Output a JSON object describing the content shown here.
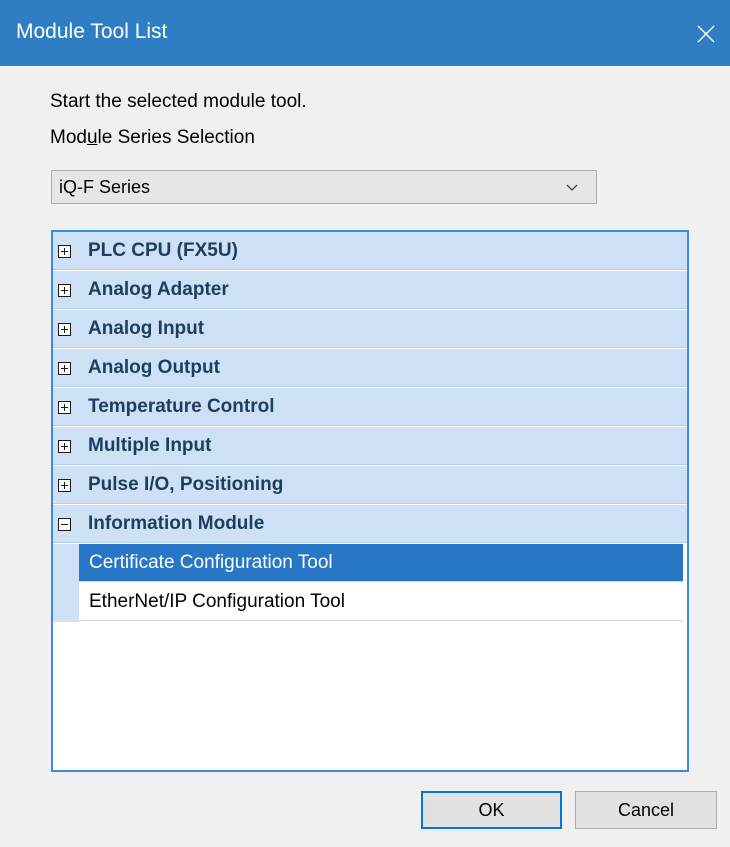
{
  "window": {
    "title": "Module Tool List"
  },
  "instructions": {
    "line1": "Start the selected module tool.",
    "line2_pre": "Mod",
    "line2_acc": "u",
    "line2_post": "le Series Selection"
  },
  "series_select": {
    "value": "iQ-F Series"
  },
  "tree": {
    "categories": [
      {
        "label": "PLC CPU (FX5U)",
        "expanded": false
      },
      {
        "label": "Analog Adapter",
        "expanded": false
      },
      {
        "label": "Analog Input",
        "expanded": false
      },
      {
        "label": "Analog Output",
        "expanded": false
      },
      {
        "label": "Temperature Control",
        "expanded": false
      },
      {
        "label": "Multiple Input",
        "expanded": false
      },
      {
        "label": "Pulse I/O, Positioning",
        "expanded": false
      },
      {
        "label": "Information Module",
        "expanded": true
      }
    ],
    "children": [
      {
        "label": "Certificate Configuration Tool",
        "selected": true
      },
      {
        "label": "EtherNet/IP Configuration Tool",
        "selected": false
      }
    ]
  },
  "buttons": {
    "ok": "OK",
    "cancel": "Cancel"
  },
  "colors": {
    "titlebar": "#2f7ec3",
    "category_bg": "#cde0f4",
    "selection": "#2876c6",
    "tree_border": "#3d8be0"
  },
  "icons": {
    "close": "close-icon",
    "dropdown": "chevron-down-icon",
    "expand": "plus-box-icon",
    "collapse": "minus-box-icon"
  }
}
